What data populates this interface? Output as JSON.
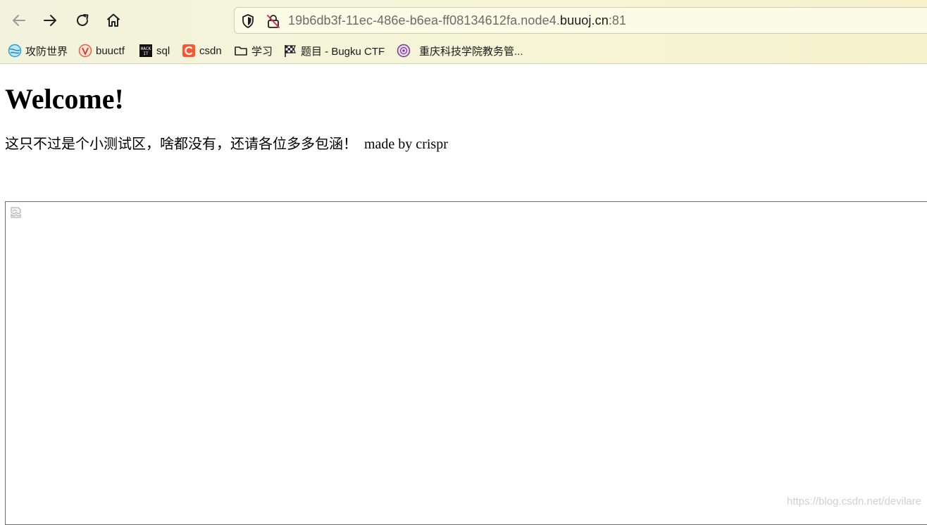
{
  "browser": {
    "toolbar": {
      "back_icon": "arrow-left-icon",
      "forward_icon": "arrow-right-icon",
      "reload_icon": "reload-icon",
      "home_icon": "home-icon"
    },
    "url": {
      "prefix": "19b6db3f-11ec-486e-b6ea-ff08134612fa.node4.",
      "host": "buuoj.cn",
      "port": ":81"
    },
    "bookmarks": [
      {
        "label": "攻防世界",
        "icon": "adworld-icon"
      },
      {
        "label": "buuctf",
        "icon": "buuctf-icon"
      },
      {
        "label": "sql",
        "icon": "hackit-icon"
      },
      {
        "label": "csdn",
        "icon": "csdn-icon"
      },
      {
        "label": "学习",
        "icon": "folder-icon"
      },
      {
        "label": "题目 - Bugku CTF",
        "icon": "bugku-flag-icon"
      },
      {
        "label": "重庆科技学院教务管...",
        "icon": "school-icon"
      }
    ]
  },
  "page": {
    "heading": "Welcome!",
    "desc_cn": "这只不过是个小测试区，啥都没有，还请各位多多包涵！",
    "desc_en": "made by crispr"
  },
  "watermark": "https://blog.csdn.net/devilare",
  "colors": {
    "chrome_bg": "#f3f3d8",
    "csdn_red": "#fc5531",
    "frame_border": "#6f6f6f"
  }
}
